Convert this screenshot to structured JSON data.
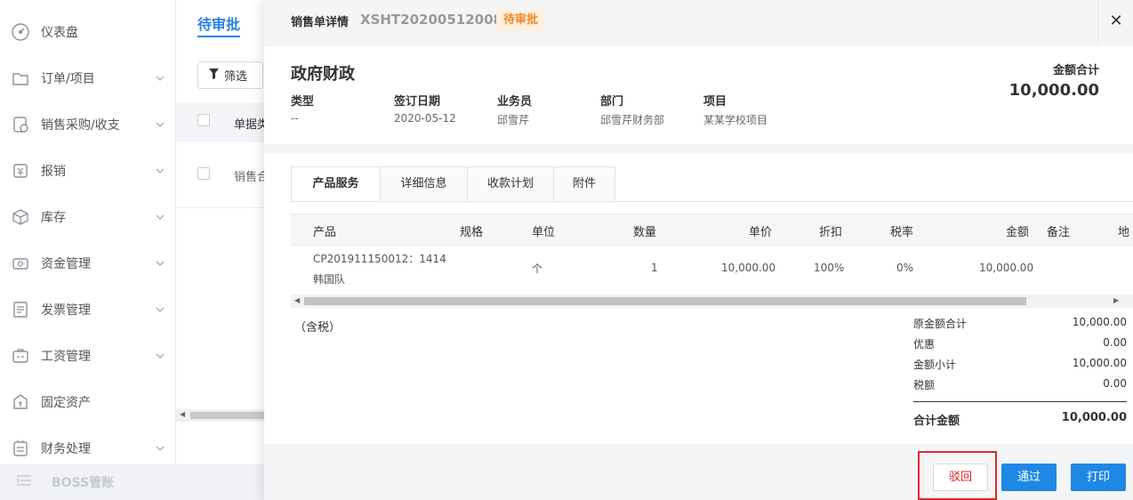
{
  "sidebar": {
    "items": [
      {
        "label": "仪表盘",
        "icon": "dashboard-icon",
        "has_submenu": false
      },
      {
        "label": "订单/项目",
        "icon": "folder-icon",
        "has_submenu": true
      },
      {
        "label": "销售采购/收支",
        "icon": "purchase-icon",
        "has_submenu": true
      },
      {
        "label": "报销",
        "icon": "reimburse-icon",
        "has_submenu": true
      },
      {
        "label": "库存",
        "icon": "cube-icon",
        "has_submenu": true
      },
      {
        "label": "资金管理",
        "icon": "funds-icon",
        "has_submenu": true
      },
      {
        "label": "发票管理",
        "icon": "invoice-icon",
        "has_submenu": true
      },
      {
        "label": "工资管理",
        "icon": "salary-icon",
        "has_submenu": true
      },
      {
        "label": "固定资产",
        "icon": "asset-icon",
        "has_submenu": false
      },
      {
        "label": "财务处理",
        "icon": "finance-icon",
        "has_submenu": true
      }
    ],
    "footer_label": "BOSS管账"
  },
  "list_page": {
    "tab_label": "待审批",
    "filter_label": "筛选",
    "header_col": "单据类",
    "row_col": "销售合"
  },
  "drawer": {
    "title": "销售单详情",
    "code": "XSHT20200512008",
    "status_badge": "待审批",
    "organization": "政府财政",
    "total_label": "金额合计",
    "total_value": "10,000.00",
    "meta": [
      {
        "label": "类型",
        "value": "--"
      },
      {
        "label": "签订日期",
        "value": "2020-05-12"
      },
      {
        "label": "业务员",
        "value": "邱雪芹"
      },
      {
        "label": "部门",
        "value": "邱雪芹财务部"
      },
      {
        "label": "项目",
        "value": "某某学校项目"
      }
    ],
    "tabs": [
      "产品服务",
      "详细信息",
      "收款计划",
      "附件"
    ],
    "active_tab": "产品服务",
    "table": {
      "headers": [
        "产品",
        "规格",
        "单位",
        "数量",
        "单价",
        "折扣",
        "税率",
        "金额",
        "备注",
        "地"
      ],
      "row": {
        "product_line1": "CP201911150012：1414",
        "product_line2": "韩国队",
        "spec": "",
        "unit": "个",
        "qty": "1",
        "price": "10,000.00",
        "discount": "100%",
        "tax_rate": "0%",
        "amount": "10,000.00",
        "remark": ""
      }
    },
    "tax_note": "（含税）",
    "summary": [
      {
        "label": "原金额合计",
        "value": "10,000.00"
      },
      {
        "label": "优惠",
        "value": "0.00"
      },
      {
        "label": "金额小计",
        "value": "10,000.00"
      },
      {
        "label": "税额",
        "value": "0.00"
      }
    ],
    "grand_total_label": "合计金额",
    "grand_total_value": "10,000.00",
    "buttons": {
      "reject": "驳回",
      "approve": "通过",
      "print": "打印"
    }
  },
  "colors": {
    "primary": "#1e88e5",
    "tab_blue": "#2b7de9",
    "badge_bg": "#fdf0de",
    "badge_text": "#f08a24",
    "reject_text": "#e02020",
    "highlight_outline": "#e02828"
  }
}
